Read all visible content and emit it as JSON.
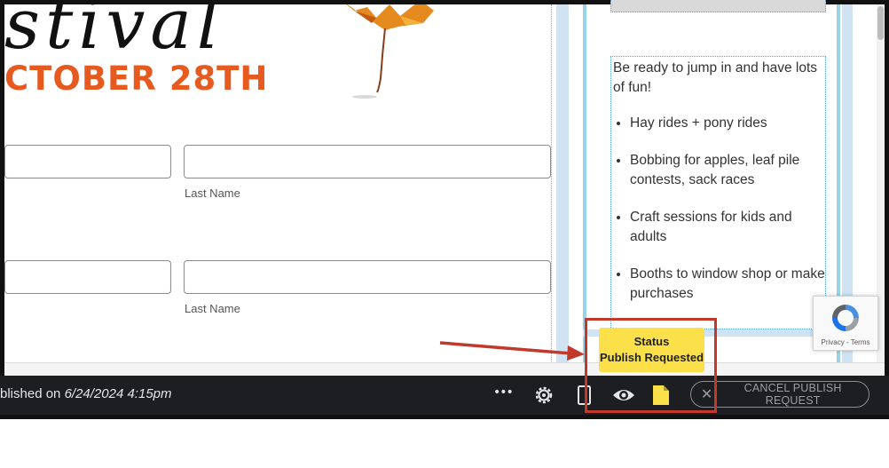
{
  "hero": {
    "script_title": "stival",
    "date_text": "CTOBER 28TH"
  },
  "form": {
    "row1_last_label": "Last Name",
    "row2_last_label": "Last Name"
  },
  "info": {
    "intro": "Be ready to jump in and have lots of fun!",
    "items": [
      "Hay rides + pony rides",
      "Bobbing for apples, leaf pile contests, sack races",
      "Craft sessions for kids and adults",
      "Booths to window shop or make purchases"
    ]
  },
  "recaptcha": {
    "label": "Privacy - Terms"
  },
  "status": {
    "title": "Status",
    "value": "Publish Requested",
    "color": "#fbe04a"
  },
  "toolbar": {
    "published_prefix": "blished on ",
    "published_date": "6/24/2024 4:15pm",
    "more_label": "•••",
    "cancel_label": "CANCEL PUBLISH REQUEST"
  },
  "colors": {
    "accent_orange": "#e65a1f",
    "highlight_red": "#c0392b",
    "toolbar_bg": "#1c1e22"
  }
}
